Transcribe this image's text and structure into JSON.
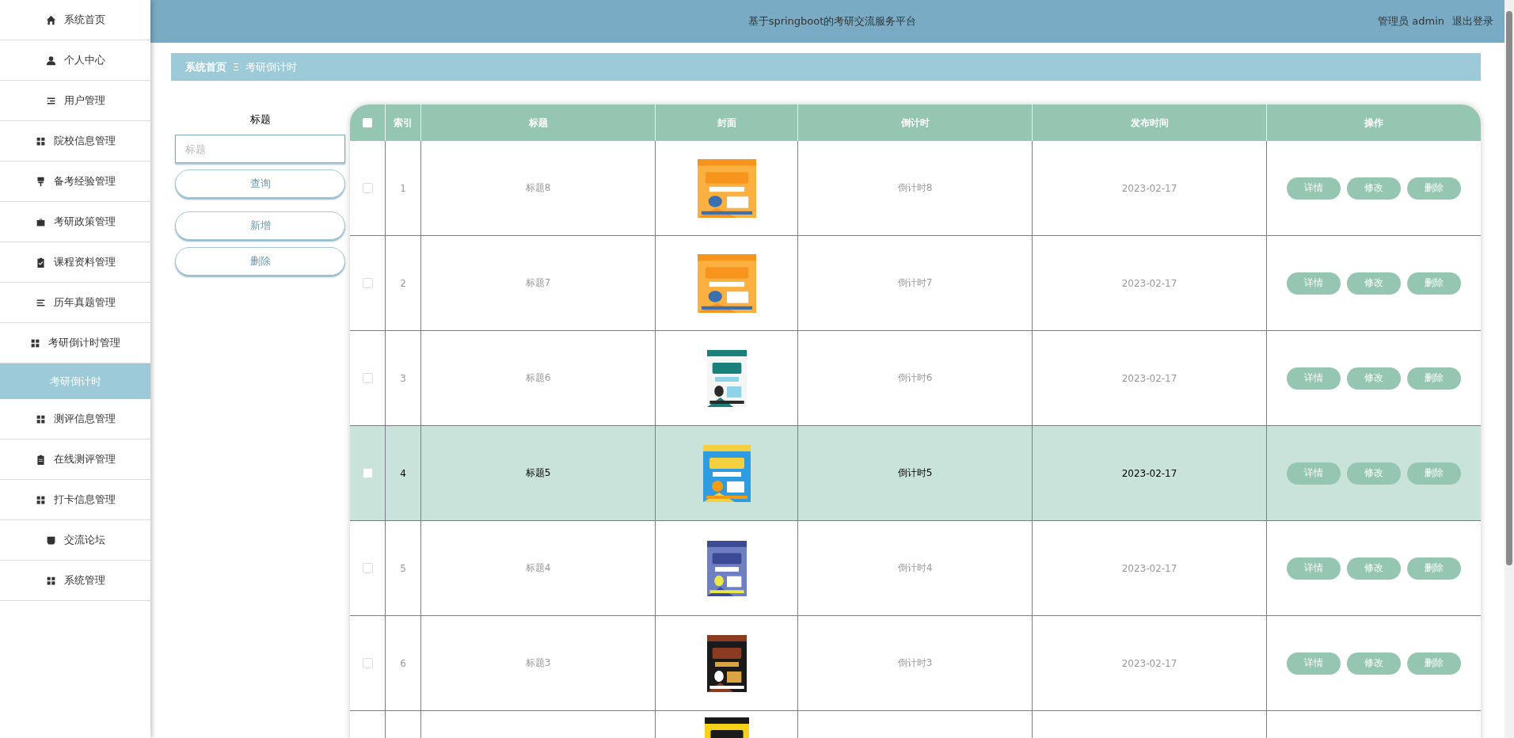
{
  "sidebar": {
    "items": [
      {
        "label": "系统首页",
        "selected": false
      },
      {
        "label": "个人中心",
        "selected": false
      },
      {
        "label": "用户管理",
        "selected": false
      },
      {
        "label": "院校信息管理",
        "selected": false
      },
      {
        "label": "备考经验管理",
        "selected": false
      },
      {
        "label": "考研政策管理",
        "selected": false
      },
      {
        "label": "课程资料管理",
        "selected": false
      },
      {
        "label": "历年真题管理",
        "selected": false
      },
      {
        "label": "考研倒计时管理",
        "selected": false,
        "children": [
          {
            "label": "考研倒计时",
            "selected": true
          }
        ]
      },
      {
        "label": "测评信息管理",
        "selected": false
      },
      {
        "label": "在线测评管理",
        "selected": false
      },
      {
        "label": "打卡信息管理",
        "selected": false
      },
      {
        "label": "交流论坛",
        "selected": false
      },
      {
        "label": "系统管理",
        "selected": false
      }
    ]
  },
  "header": {
    "title": "基于springboot的考研交流服务平台",
    "user": "管理员 admin",
    "logout": "退出登录"
  },
  "breadcrumb": {
    "items": [
      "系统首页",
      "考研倒计时"
    ],
    "separator": "Ξ"
  },
  "search": {
    "label": "标题",
    "placeholder": "标题",
    "buttons": [
      "查询",
      "新增",
      "删除"
    ]
  },
  "table": {
    "columns": [
      "索引",
      "标题",
      "封面",
      "倒计时",
      "发布时间",
      "操作"
    ],
    "select_all_checked": false,
    "rows": [
      {
        "kind": "row",
        "index": "1",
        "title": "标题8",
        "countdown": "倒计时8",
        "date": "2023-02-17",
        "highlighted": false,
        "checked": false,
        "actions": [
          "详情",
          "修改",
          "删除"
        ]
      },
      {
        "kind": "row",
        "index": "2",
        "title": "标题7",
        "countdown": "倒计时7",
        "date": "2023-02-17",
        "highlighted": false,
        "checked": false,
        "actions": [
          "详情",
          "修改",
          "删除"
        ]
      },
      {
        "kind": "row",
        "index": "3",
        "title": "标题6",
        "countdown": "倒计时6",
        "date": "2023-02-17",
        "highlighted": false,
        "checked": false,
        "actions": [
          "详情",
          "修改",
          "删除"
        ]
      },
      {
        "kind": "row",
        "index": "4",
        "title": "标题5",
        "countdown": "倒计时5",
        "date": "2023-02-17",
        "highlighted": true,
        "checked": false,
        "actions": [
          "详情",
          "修改",
          "删除"
        ]
      },
      {
        "kind": "row",
        "index": "5",
        "title": "标题4",
        "countdown": "倒计时4",
        "date": "2023-02-17",
        "highlighted": false,
        "checked": false,
        "actions": [
          "详情",
          "修改",
          "删除"
        ]
      },
      {
        "kind": "row",
        "index": "6",
        "title": "标题3",
        "countdown": "倒计时3",
        "date": "2023-02-17",
        "highlighted": false,
        "checked": false,
        "actions": [
          "详情",
          "修改",
          "删除"
        ]
      },
      {
        "kind": "cut-off"
      }
    ]
  }
}
